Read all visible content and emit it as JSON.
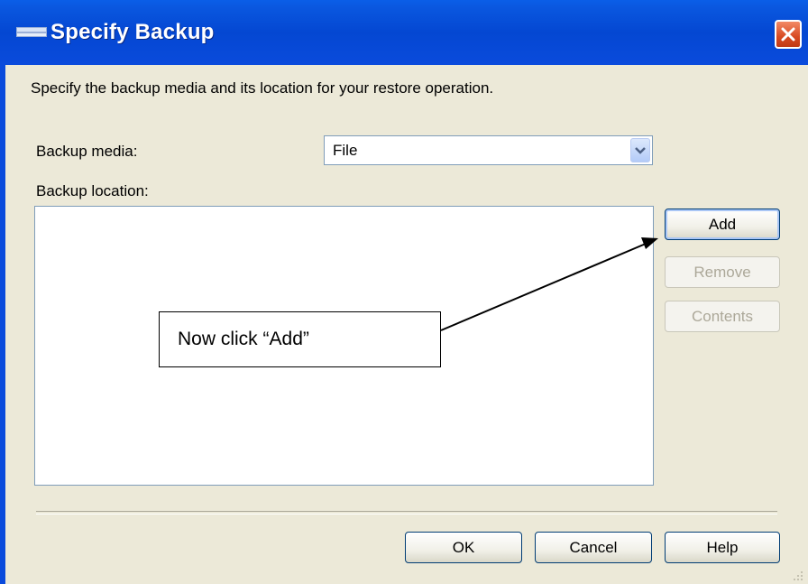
{
  "window": {
    "title": "Specify Backup"
  },
  "dialog": {
    "instruction": "Specify the backup media and its location for your restore operation.",
    "backup_media_label": "Backup media:",
    "backup_media_value": "File",
    "backup_location_label": "Backup location:",
    "backup_location_items": []
  },
  "side_buttons": {
    "add": "Add",
    "remove": "Remove",
    "contents": "Contents"
  },
  "footer_buttons": {
    "ok": "OK",
    "cancel": "Cancel",
    "help": "Help"
  },
  "annotation": {
    "text": "Now click “Add”"
  },
  "icons": {
    "title_icon": "window-app-icon",
    "close": "close-icon",
    "dropdown": "chevron-down-icon"
  },
  "colors": {
    "titlebar": "#0447d2",
    "dialog_bg": "#ece9d8",
    "close_button": "#d84a22"
  }
}
